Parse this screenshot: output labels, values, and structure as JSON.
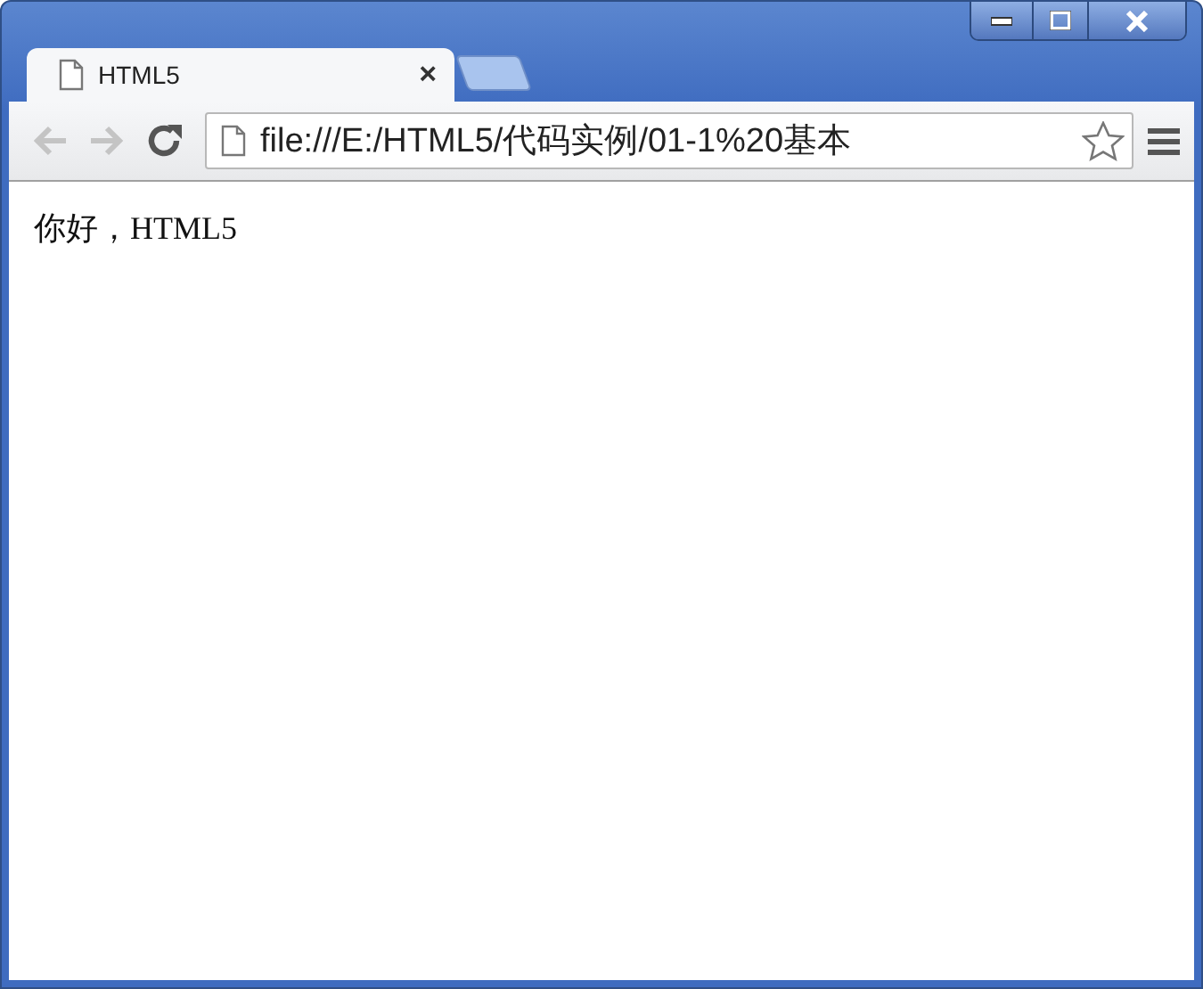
{
  "tabs": [
    {
      "title": "HTML5",
      "close": "×",
      "selected": true
    }
  ],
  "toolbar": {
    "back": {
      "disabled": true
    },
    "forward": {
      "disabled": true
    },
    "address": {
      "value": "file:///E:/HTML5/代码实例/01-1%20基本"
    },
    "bookmarked": false
  },
  "page": {
    "text": "你好，HTML5"
  }
}
